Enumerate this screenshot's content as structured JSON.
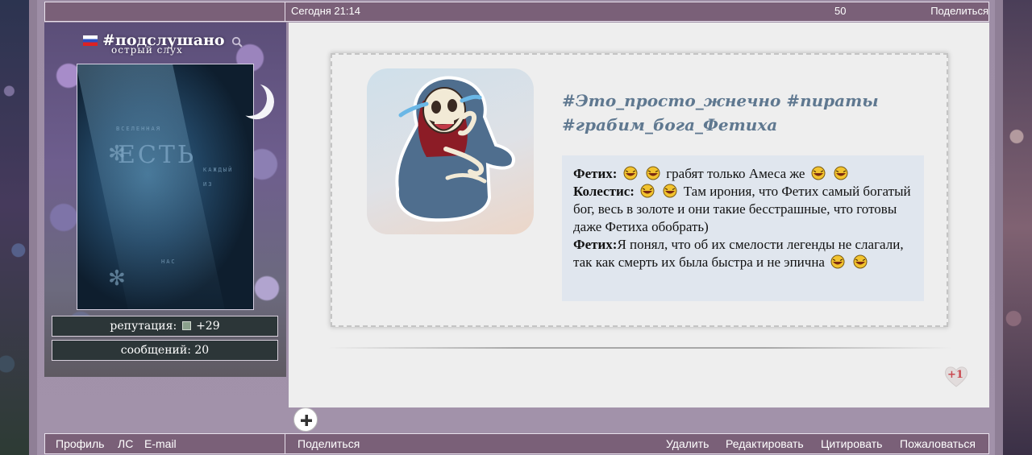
{
  "topbar": {
    "date": "Сегодня 21:14",
    "number": "50",
    "share": "Поделиться"
  },
  "sidebar": {
    "flag_icon": "russia-flag-icon",
    "title": "#подслушано",
    "subtitle": "острый слух",
    "search_icon": "search-icon",
    "avatar_text": {
      "top": "ВСЕЛЕННАЯ",
      "word": "ЕСТЬ",
      "right1": "КАЖДЫЙ",
      "right2": "ИЗ",
      "bottom": "НАС"
    },
    "reputation_label": "репутация:",
    "reputation_value": "+29",
    "messages_label": "сообщений:",
    "messages_value": "20"
  },
  "post": {
    "tags_line1": "#Это_просто_жнечно #пираты",
    "tags_line2": "#грабим_бога_Фетиха",
    "quote": {
      "l1_name": "Фетих:",
      "l1_text": "грабят только Амеса же",
      "l2_name": "Колестис:",
      "l2_text": "Там ирония, что Фетих самый богатый бог, весь в золоте и они такие бесстрашные, что готовы даже Фетиха обобрать)",
      "l3_name": "Фетих:",
      "l3_text": "Я понял, что об их смелости легенды не слагали, так как смерть их была быстра и не эпична"
    },
    "like_count": "+1"
  },
  "bottombar": {
    "profile": "Профиль",
    "pm": "ЛС",
    "email": "E-mail",
    "share": "Поделиться",
    "delete": "Удалить",
    "edit": "Редактировать",
    "quote": "Цитировать",
    "report": "Пожаловаться"
  },
  "colors": {
    "bar": "#7a6078",
    "tags": "#5f7890",
    "quote_bg": "#e0e6ee",
    "like": "#c94850"
  }
}
